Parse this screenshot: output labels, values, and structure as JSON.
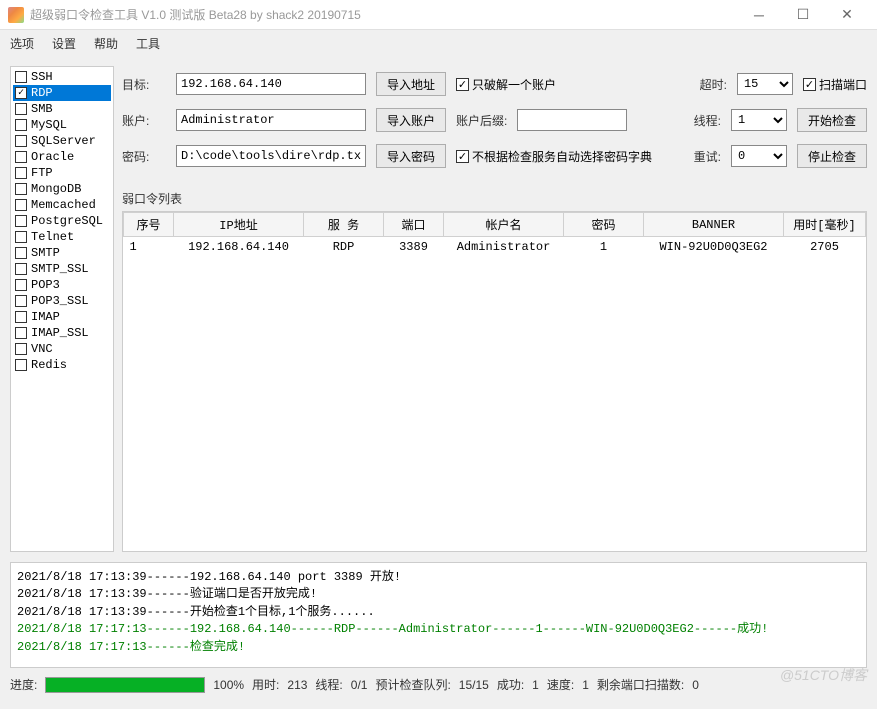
{
  "window": {
    "title": "超级弱口令检查工具 V1.0 测试版 Beta28 by shack2 20190715"
  },
  "menu": {
    "items": [
      "选项",
      "设置",
      "帮助",
      "工具"
    ]
  },
  "protocols": [
    {
      "name": "SSH",
      "checked": false,
      "selected": false
    },
    {
      "name": "RDP",
      "checked": true,
      "selected": true
    },
    {
      "name": "SMB",
      "checked": false,
      "selected": false
    },
    {
      "name": "MySQL",
      "checked": false,
      "selected": false
    },
    {
      "name": "SQLServer",
      "checked": false,
      "selected": false
    },
    {
      "name": "Oracle",
      "checked": false,
      "selected": false
    },
    {
      "name": "FTP",
      "checked": false,
      "selected": false
    },
    {
      "name": "MongoDB",
      "checked": false,
      "selected": false
    },
    {
      "name": "Memcached",
      "checked": false,
      "selected": false
    },
    {
      "name": "PostgreSQL",
      "checked": false,
      "selected": false
    },
    {
      "name": "Telnet",
      "checked": false,
      "selected": false
    },
    {
      "name": "SMTP",
      "checked": false,
      "selected": false
    },
    {
      "name": "SMTP_SSL",
      "checked": false,
      "selected": false
    },
    {
      "name": "POP3",
      "checked": false,
      "selected": false
    },
    {
      "name": "POP3_SSL",
      "checked": false,
      "selected": false
    },
    {
      "name": "IMAP",
      "checked": false,
      "selected": false
    },
    {
      "name": "IMAP_SSL",
      "checked": false,
      "selected": false
    },
    {
      "name": "VNC",
      "checked": false,
      "selected": false
    },
    {
      "name": "Redis",
      "checked": false,
      "selected": false
    }
  ],
  "form": {
    "target_label": "目标:",
    "target_value": "192.168.64.140",
    "import_target_btn": "导入地址",
    "only_one_check": "只破解一个账户",
    "only_one_checked": true,
    "timeout_label": "超时:",
    "timeout_value": "15",
    "scan_port_check": "扫描端口",
    "scan_port_checked": true,
    "account_label": "账户:",
    "account_value": "Administrator",
    "import_account_btn": "导入账户",
    "account_suffix_label": "账户后缀:",
    "account_suffix_value": "",
    "threads_label": "线程:",
    "threads_value": "1",
    "start_btn": "开始检查",
    "password_label": "密码:",
    "password_value": "D:\\code\\tools\\dire\\rdp.tx",
    "import_password_btn": "导入密码",
    "no_auto_dict_check": "不根据检查服务自动选择密码字典",
    "no_auto_dict_checked": true,
    "retry_label": "重试:",
    "retry_value": "0",
    "stop_btn": "停止检查"
  },
  "table": {
    "title": "弱口令列表",
    "headers": [
      "序号",
      "IP地址",
      "服 务",
      "端口",
      "帐户名",
      "密码",
      "BANNER",
      "用时[毫秒]"
    ],
    "rows": [
      {
        "seq": "1",
        "ip": "192.168.64.140",
        "service": "RDP",
        "port": "3389",
        "account": "Administrator",
        "password": "1",
        "banner": "WIN-92U0D0Q3EG2",
        "time": "2705"
      }
    ]
  },
  "log": [
    {
      "text": "2021/8/18 17:13:39------192.168.64.140 port 3389 开放!",
      "green": false
    },
    {
      "text": "2021/8/18 17:13:39------验证端口是否开放完成!",
      "green": false
    },
    {
      "text": "2021/8/18 17:13:39------开始检查1个目标,1个服务......",
      "green": false
    },
    {
      "text": "2021/8/18 17:17:13------192.168.64.140------RDP------Administrator------1------WIN-92U0D0Q3EG2------成功!",
      "green": true
    },
    {
      "text": "2021/8/18 17:17:13------检查完成!",
      "green": true
    }
  ],
  "status": {
    "progress_label": "进度:",
    "progress_pct": "100%",
    "elapsed_label": "用时:",
    "elapsed_value": "213",
    "threads_label": "线程:",
    "threads_value": "0/1",
    "queue_label": "预计检查队列:",
    "queue_value": "15/15",
    "success_label": "成功:",
    "success_value": "1",
    "speed_label": "速度:",
    "speed_value": "1",
    "remaining_label": "剩余端口扫描数:",
    "remaining_value": "0"
  },
  "watermark": "@51CTO博客"
}
